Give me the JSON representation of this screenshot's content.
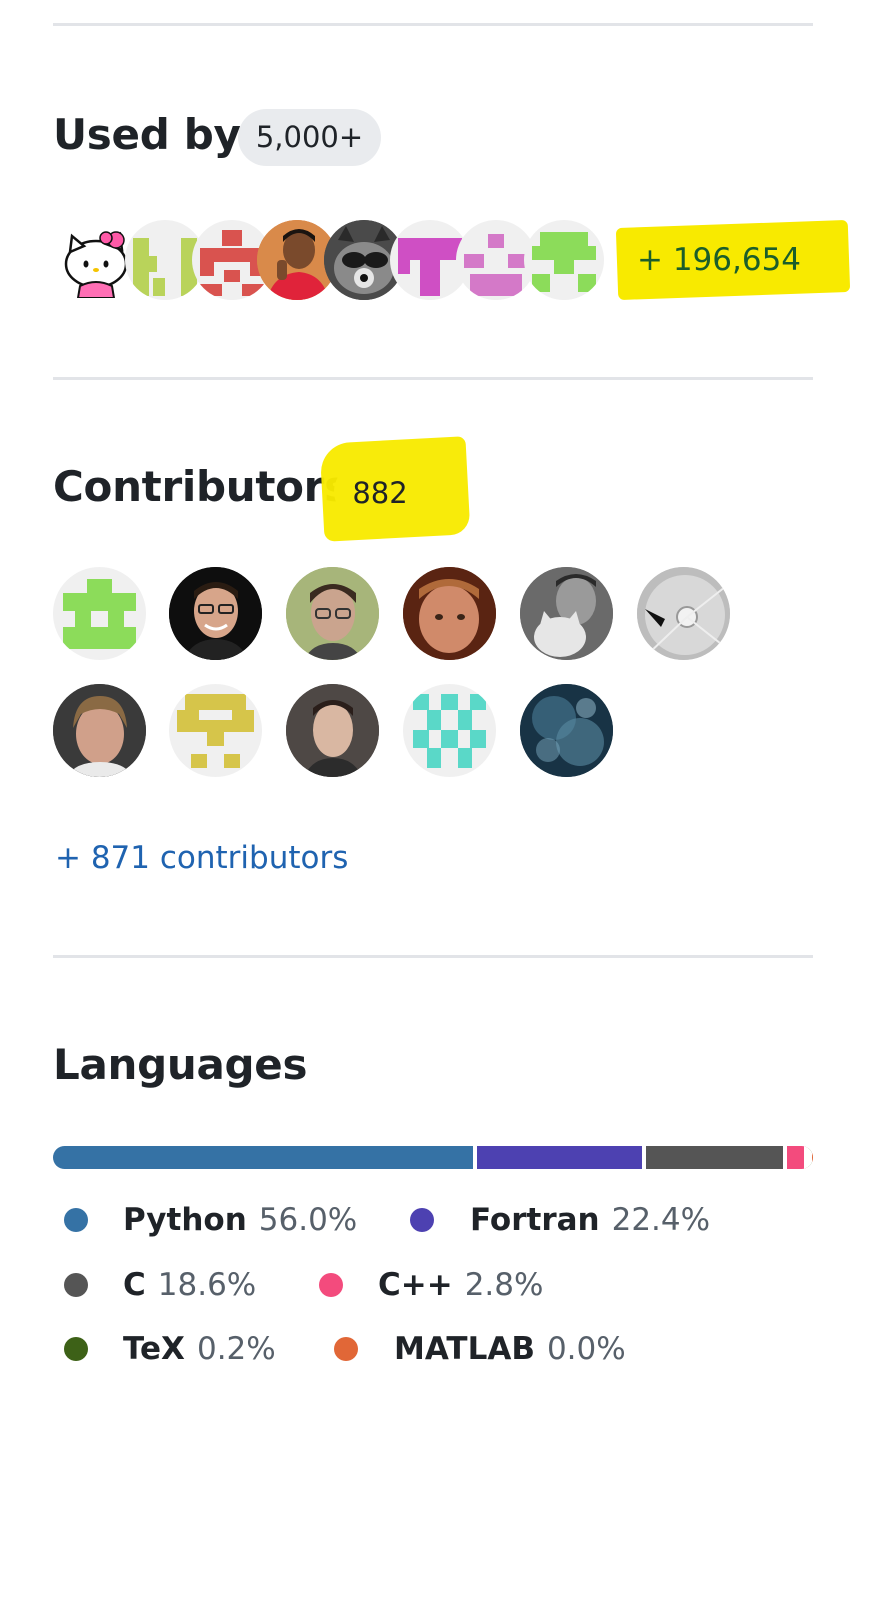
{
  "used_by": {
    "title": "Used by",
    "count": "5,000+",
    "more": "+ 196,654",
    "avatars": [
      "hello-kitty-avatar",
      "identicon-lime",
      "identicon-red",
      "photo-avatar-man",
      "raccoon-avatar",
      "identicon-magenta",
      "identicon-pink",
      "identicon-green"
    ]
  },
  "contributors": {
    "title": "Contributors",
    "count": "882",
    "more_link": "+ 871 contributors",
    "avatars": [
      "identicon-green",
      "photo-man-glasses",
      "photo-man-glasses-2",
      "photo-man",
      "photo-man-cat",
      "photo-abstract-grey",
      "photo-man-blond",
      "identicon-yellow",
      "photo-man-dark",
      "identicon-teal",
      "photo-abstract-blue"
    ]
  },
  "languages": {
    "title": "Languages",
    "items": [
      {
        "name": "Python",
        "percent": "56.0%",
        "value": 56.0,
        "color": "#3572A5"
      },
      {
        "name": "Fortran",
        "percent": "22.4%",
        "value": 22.4,
        "color": "#4d41b1"
      },
      {
        "name": "C",
        "percent": "18.6%",
        "value": 18.6,
        "color": "#555555"
      },
      {
        "name": "C++",
        "percent": "2.8%",
        "value": 2.8,
        "color": "#f34b7d"
      },
      {
        "name": "TeX",
        "percent": "0.2%",
        "value": 0.2,
        "color": "#3D6117"
      },
      {
        "name": "MATLAB",
        "percent": "0.0%",
        "value": 0.0,
        "color": "#e16737"
      }
    ]
  }
}
